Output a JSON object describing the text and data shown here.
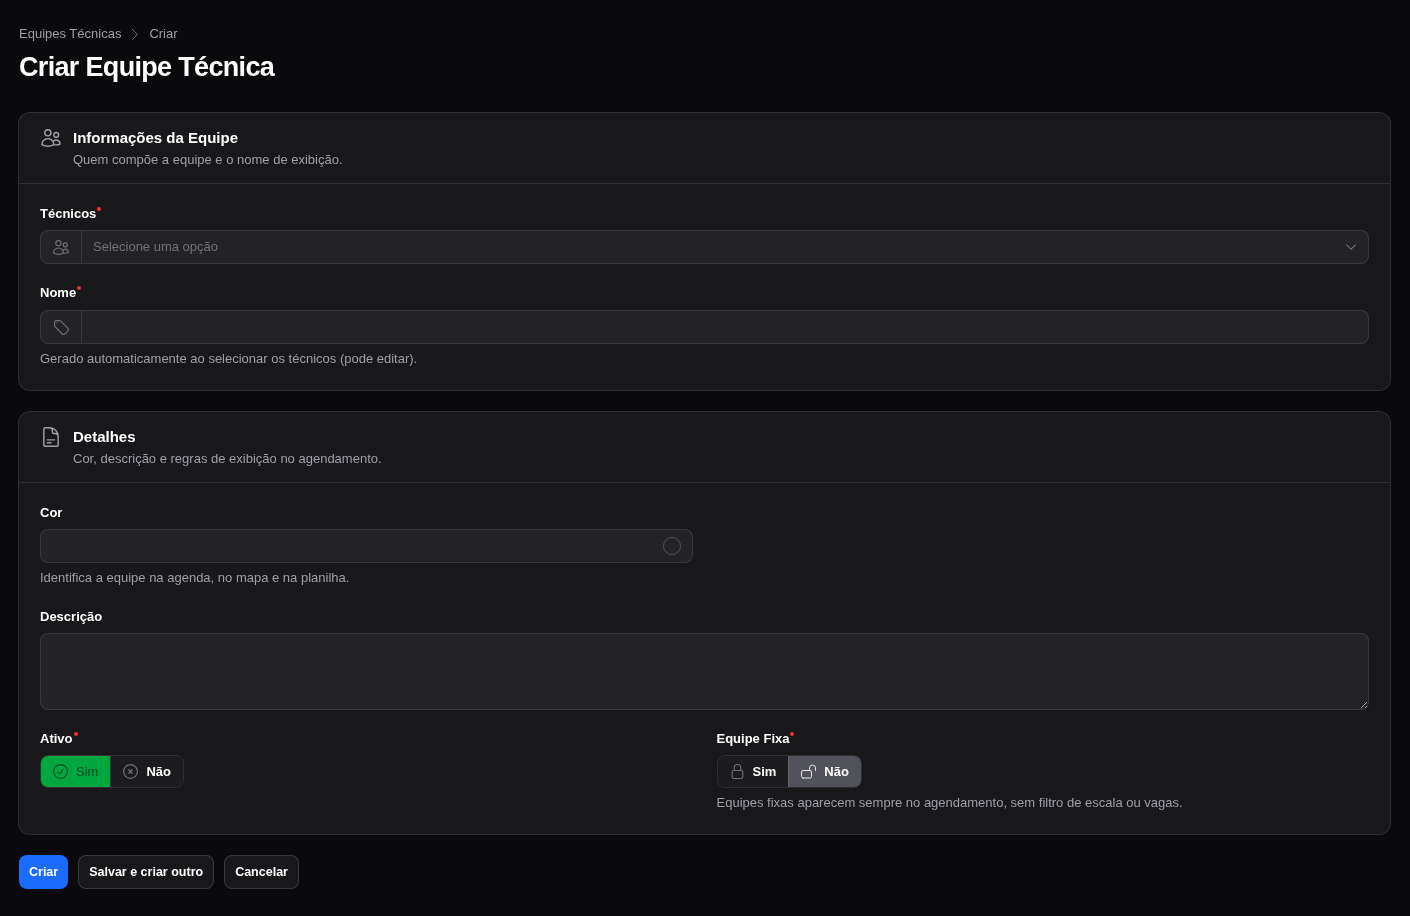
{
  "breadcrumbs": [
    {
      "label": "Equipes Técnicas"
    },
    {
      "label": "Criar"
    }
  ],
  "title": "Criar Equipe Técnica",
  "sections": [
    {
      "title": "Informações da Equipe",
      "description": "Quem compõe a equipe e o nome de exibição.",
      "fields": [
        {
          "kind": "select",
          "label": "Técnicos",
          "required": true,
          "placeholder": "Selecione uma opção"
        },
        {
          "kind": "text",
          "label": "Nome",
          "required": true,
          "hint": "Gerado automaticamente ao selecionar os técnicos (pode editar)."
        }
      ]
    },
    {
      "title": "Detalhes",
      "description": "Cor, descrição e regras de exibição no agendamento.",
      "fields": [
        {
          "kind": "color",
          "label": "Cor",
          "required": false,
          "hint": "Identifica a equipe na agenda, no mapa e na planilha."
        },
        {
          "kind": "textarea",
          "label": "Descrição",
          "required": false
        },
        {
          "kind": "toggle",
          "label": "Ativo",
          "required": true,
          "options": [
            {
              "label": "Sim",
              "selected": true,
              "color": "#00a63e"
            },
            {
              "label": "Não",
              "selected": false
            }
          ]
        },
        {
          "kind": "toggle",
          "label": "Equipe Fixa",
          "required": true,
          "options": [
            {
              "label": "Sim",
              "selected": false
            },
            {
              "label": "Não",
              "selected": true
            }
          ],
          "hint": "Equipes fixas aparecem sempre no agendamento, sem filtro de escala ou vagas."
        }
      ]
    }
  ],
  "actions": [
    {
      "label": "Criar",
      "kind": "primary"
    },
    {
      "label": "Salvar e criar outro",
      "kind": "secondary"
    },
    {
      "label": "Cancelar",
      "kind": "secondary"
    }
  ]
}
